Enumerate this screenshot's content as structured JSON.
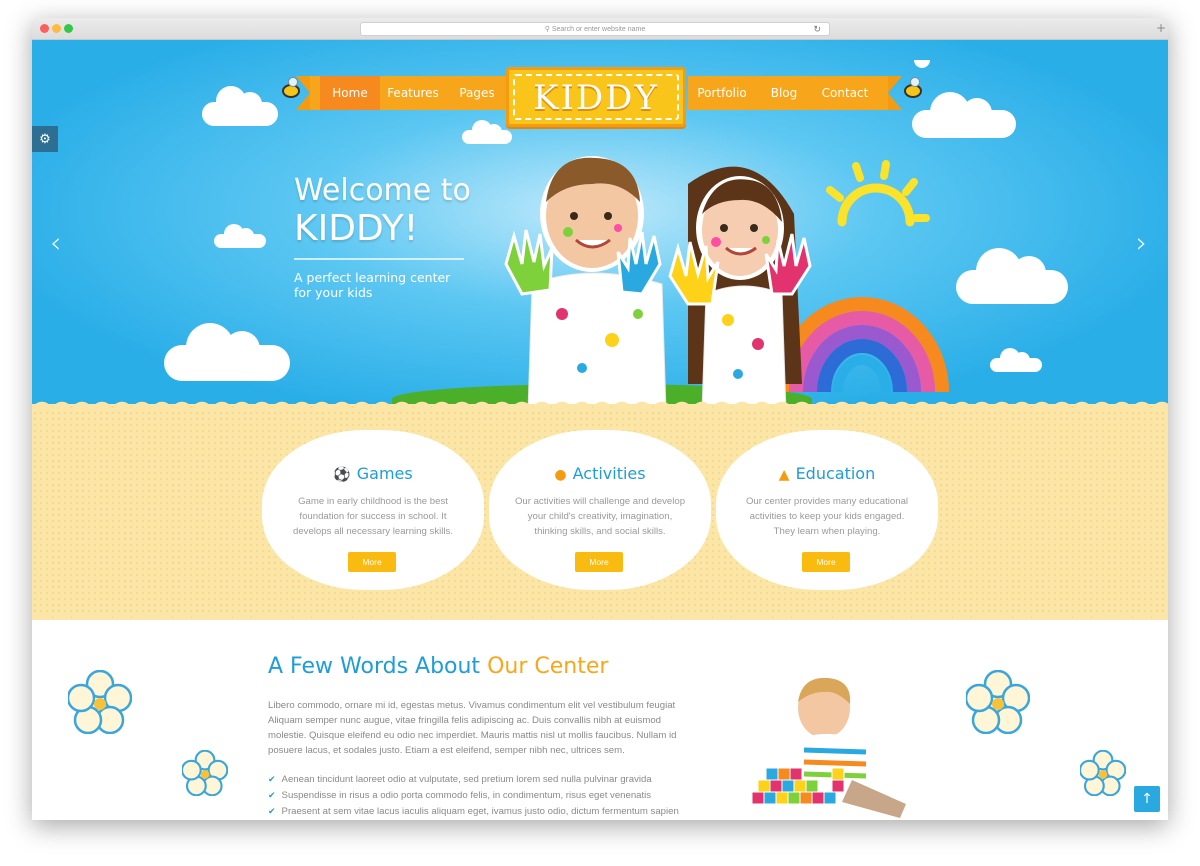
{
  "browser": {
    "url_placeholder": "Search or enter website name",
    "reload_icon": "reload-icon",
    "new_tab_icon": "plus-icon"
  },
  "nav": {
    "items": [
      {
        "label": "Home",
        "active": true
      },
      {
        "label": "Features"
      },
      {
        "label": "Pages"
      },
      {
        "label": "Portfolio"
      },
      {
        "label": "Blog"
      },
      {
        "label": "Contact"
      }
    ],
    "logo": "KIDDY"
  },
  "hero": {
    "line1": "Welcome to",
    "line2": "KIDDY!",
    "tagline": "A perfect learning center for your kids",
    "prev_icon": "chevron-left-icon",
    "next_icon": "chevron-right-icon",
    "settings_icon": "gears-icon"
  },
  "features": [
    {
      "icon": "games-icon",
      "title": "Games",
      "text": "Game in early childhood is the best foundation for success in school. It develops all necessary learning skills.",
      "button": "More"
    },
    {
      "icon": "activities-icon",
      "title": "Activities",
      "text": "Our activities will challenge and develop your child's creativity, imagination, thinking skills, and social skills.",
      "button": "More"
    },
    {
      "icon": "education-icon",
      "title": "Education",
      "text": "Our center provides many educational activities to keep your kids engaged. They learn when playing.",
      "button": "More"
    }
  ],
  "about": {
    "title_prefix": "A Few Words About ",
    "title_highlight": "Our Center",
    "text": "Libero commodo, ornare mi id, egestas metus. Vivamus condimentum elit vel vestibulum feugiat Aliquam semper nunc augue, vitae fringilla felis adipiscing ac. Duis convallis nibh at euismod molestie. Quisque eleifend eu odio nec imperdiet. Mauris mattis nisl ut mollis faucibus. Nullam id posuere lacus, et sodales justo. Etiam a est eleifend, semper nibh nec, ultrices sem.",
    "bullets": [
      "Aenean tincidunt laoreet odio at vulputate, sed pretium lorem sed nulla pulvinar gravida",
      "Suspendisse in risus a odio porta commodo felis, in condimentum, risus eget venenatis",
      "Praesent at sem vitae lacus iaculis aliquam eget, ivamus justo odio, dictum fermentum sapien"
    ]
  },
  "back_to_top_icon": "arrow-up-icon",
  "colors": {
    "sky": "#2aaee8",
    "orange": "#f7a51a",
    "blue_text": "#1e9dd6",
    "sand": "#fbe6a8"
  }
}
